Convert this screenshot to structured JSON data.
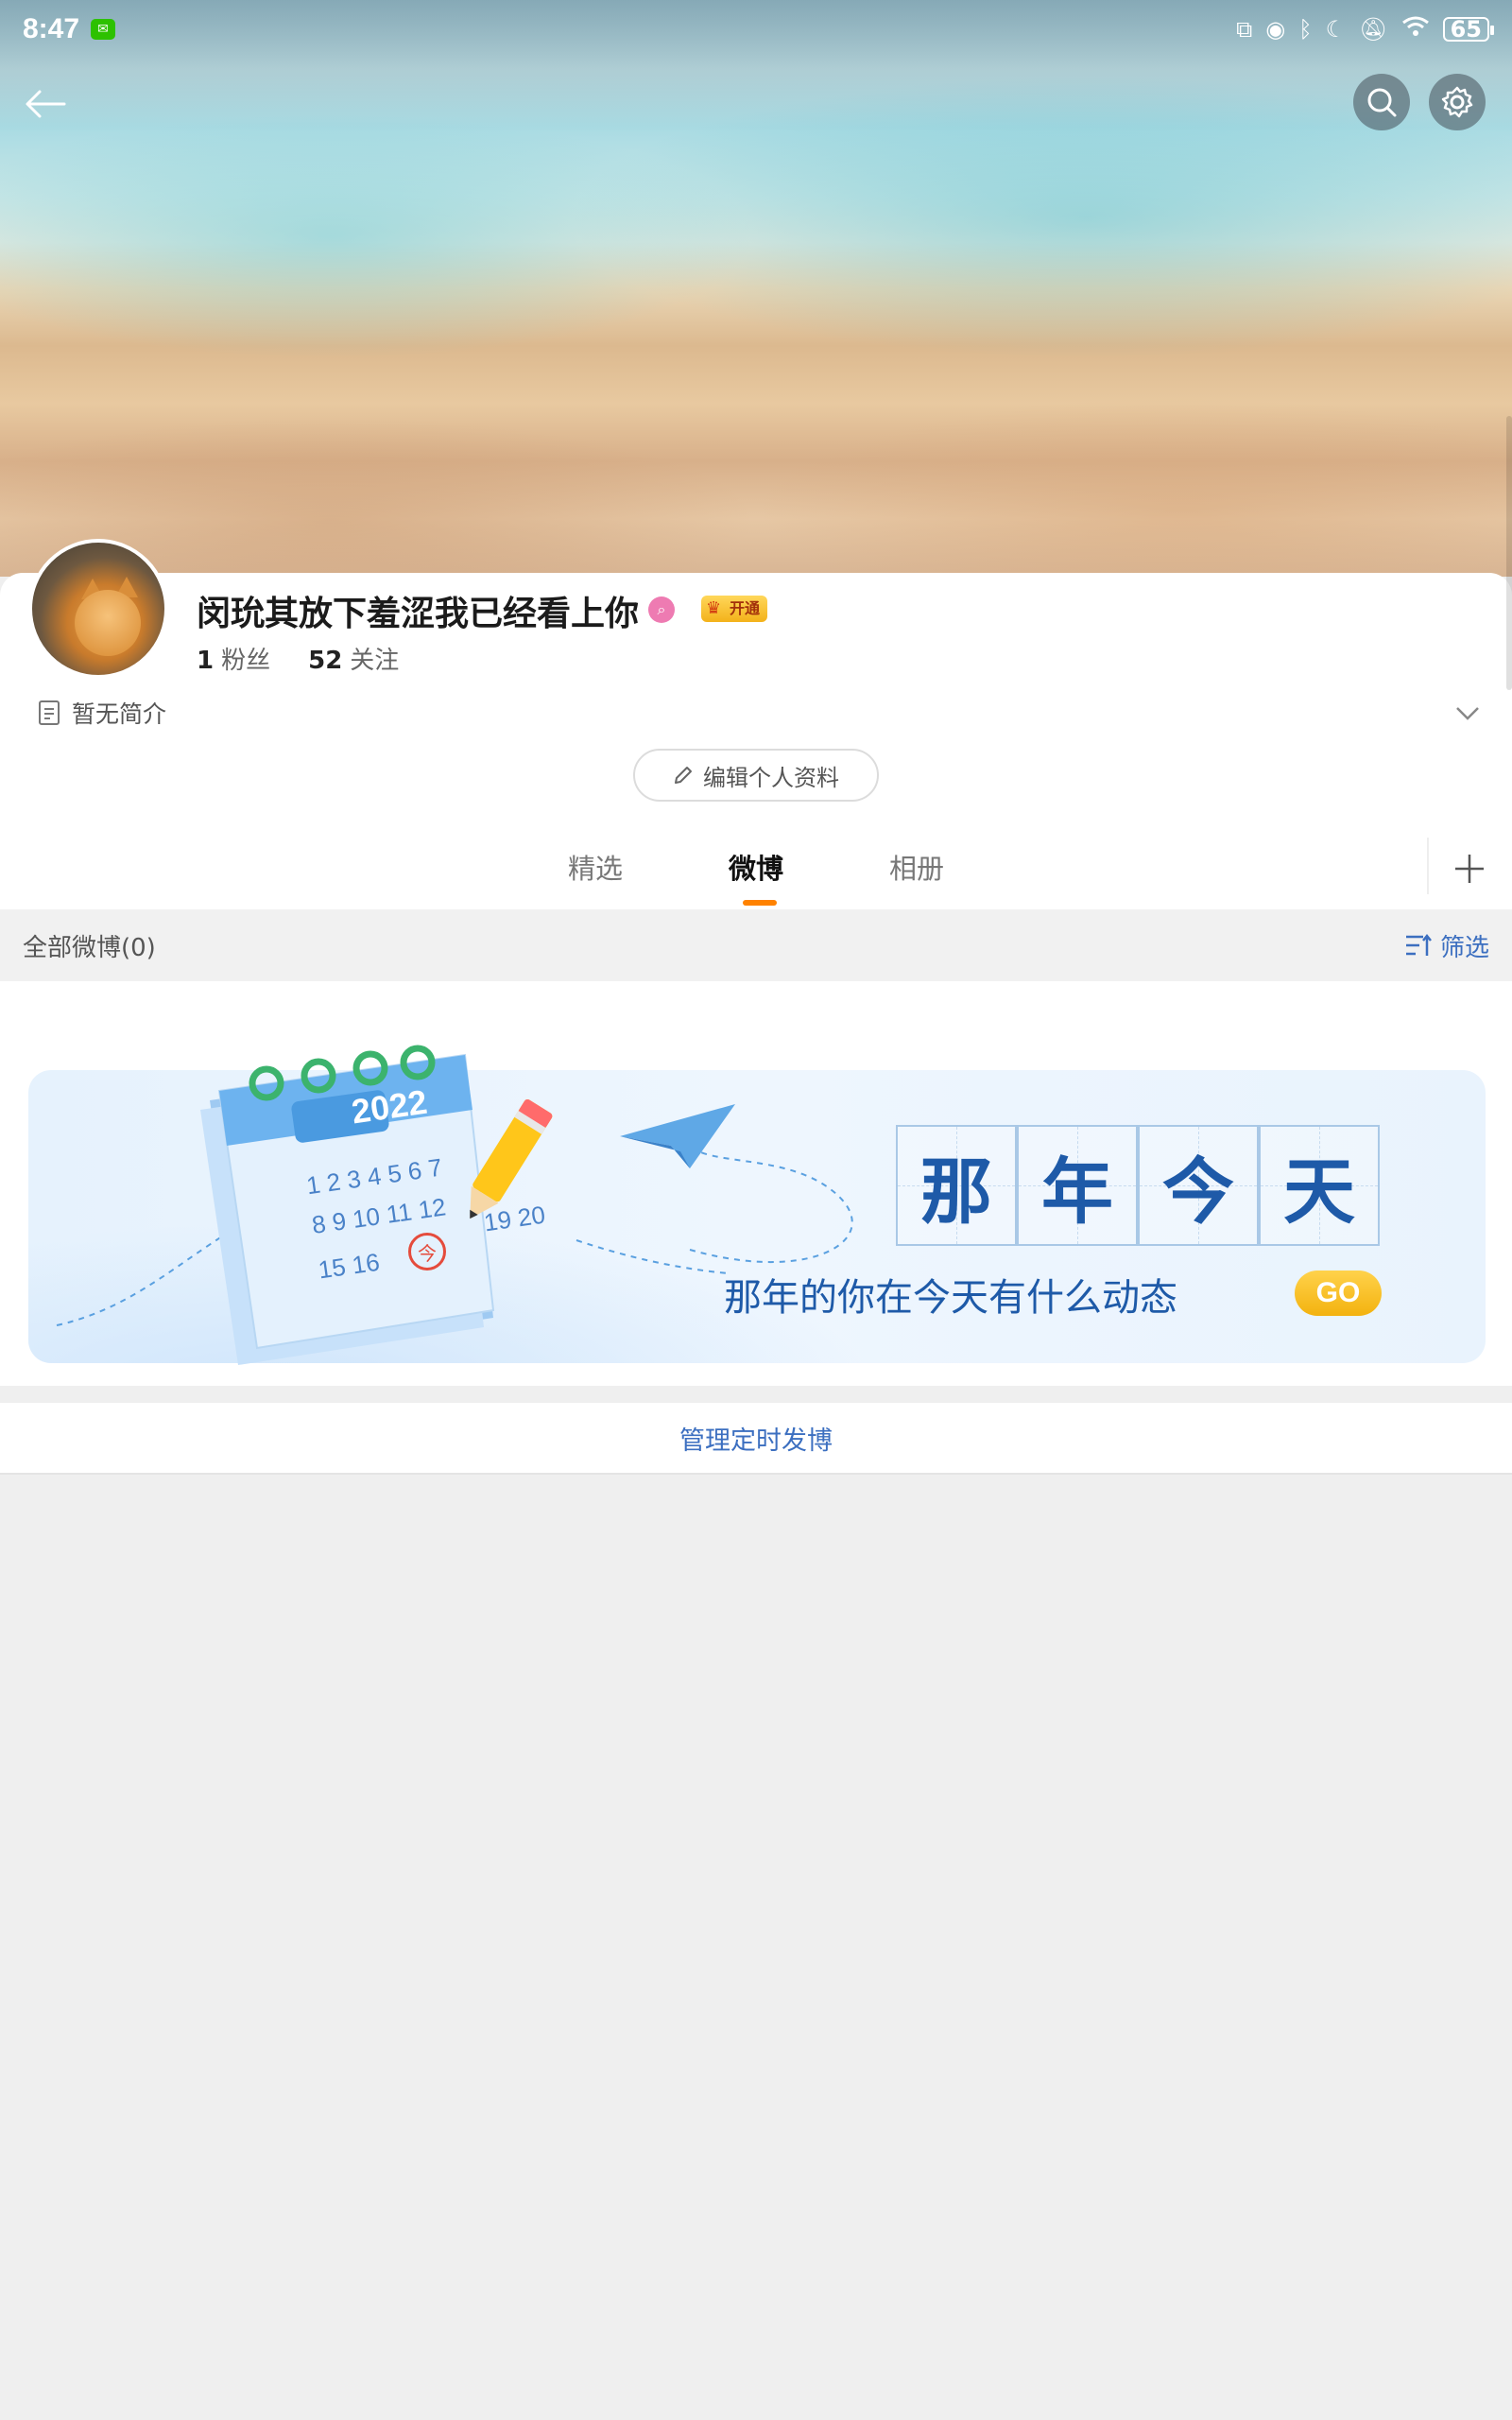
{
  "status_bar": {
    "time": "8:47",
    "battery": "65",
    "icons": [
      "wechat-icon",
      "cast-icon",
      "eye-icon",
      "bluetooth-icon",
      "moon-icon",
      "mute-bell-icon",
      "wifi-icon",
      "battery-icon"
    ]
  },
  "header": {
    "back_icon": "back-arrow-icon",
    "search_icon": "search-icon",
    "settings_icon": "gear-icon"
  },
  "profile": {
    "username": "闵玧其放下羞涩我已经看上你",
    "vip_badge": "开通",
    "followers_count": "1",
    "followers_label": "粉丝",
    "following_count": "52",
    "following_label": "关注",
    "bio": "暂无简介",
    "edit_button": "编辑个人资料"
  },
  "tabs": [
    {
      "label": "精选",
      "active": false
    },
    {
      "label": "微博",
      "active": true
    },
    {
      "label": "相册",
      "active": false
    }
  ],
  "filter_bar": {
    "summary": "全部微博(0)",
    "filter_label": "筛选"
  },
  "banner": {
    "title_chars": [
      "那",
      "年",
      "今",
      "天"
    ],
    "subtitle": "那年的你在今天有什么动态",
    "go_label": "GO",
    "calendar_year": "2022",
    "calendar_rows": [
      "1 2 3 4 5 6 7",
      "8 9 10 11 12",
      "15 16",
      "19 20"
    ],
    "today_mark": "今"
  },
  "manage_scheduled": "管理定时发博",
  "colors": {
    "accent_orange": "#ff8200",
    "link_blue": "#3c6fc0",
    "banner_blue": "#1e5aa8"
  }
}
